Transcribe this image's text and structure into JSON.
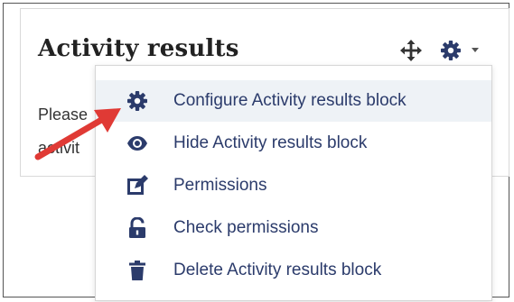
{
  "block": {
    "title": "Activity results",
    "text_line1": "Please",
    "text_line2": "activit"
  },
  "controls": {
    "move_icon": "move-arrows-icon",
    "settings_icon": "gear-icon",
    "dropdown_icon": "caret-down-icon"
  },
  "menu": {
    "items": [
      {
        "label": "Configure Activity results block",
        "icon": "gear-icon",
        "active": true
      },
      {
        "label": "Hide Activity results block",
        "icon": "eye-icon",
        "active": false
      },
      {
        "label": "Permissions",
        "icon": "edit-icon",
        "active": false
      },
      {
        "label": "Check permissions",
        "icon": "unlock-icon",
        "active": false
      },
      {
        "label": "Delete Activity results block",
        "icon": "trash-icon",
        "active": false
      }
    ]
  },
  "colors": {
    "menu_text": "#2b3b6b",
    "icon": "#2b3b6b",
    "active_bg": "#eef2f6",
    "arrow": "#e03a35"
  }
}
